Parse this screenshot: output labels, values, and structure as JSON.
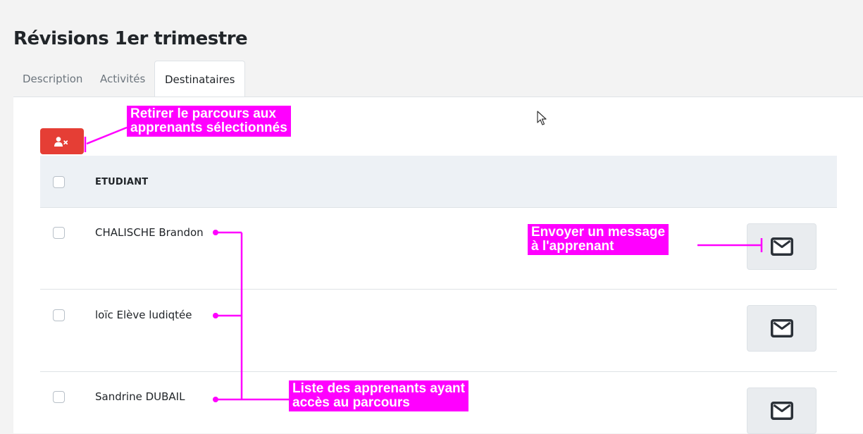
{
  "page": {
    "title": "Révisions 1er trimestre"
  },
  "tabs": [
    {
      "label": "Description"
    },
    {
      "label": "Activités"
    },
    {
      "label": "Destinataires",
      "active": true
    }
  ],
  "toolbar": {
    "remove_icon": "user-times-icon",
    "remove_color": "#e53e35"
  },
  "table": {
    "header": "ETUDIANT",
    "rows": [
      {
        "name": "CHALISCHE Brandon"
      },
      {
        "name": "loïc Elève ludiqtée"
      },
      {
        "name": "Sandrine DUBAIL"
      }
    ],
    "row_action_icon": "envelope-icon"
  },
  "annotations": {
    "remove": {
      "line1": "Retirer le parcours aux",
      "line2": "apprenants sélectionnés"
    },
    "message": {
      "line1": "Envoyer un message",
      "line2": "à l'apprenant"
    },
    "list": {
      "line1": "Liste des apprenants ayant",
      "line2": "accès au parcours"
    },
    "color": "#ff00ff"
  }
}
